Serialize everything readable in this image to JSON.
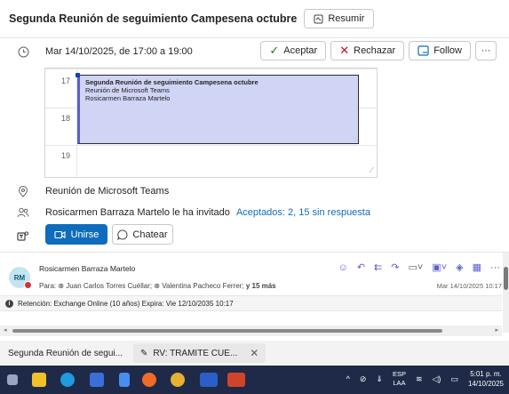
{
  "header": {
    "title": "Segunda Reunión de seguimiento Campesena octubre",
    "summarize_label": "Resumir"
  },
  "details": {
    "date_text": "Mar 14/10/2025, de 17:00 a 19:00",
    "accept_label": "Aceptar",
    "decline_label": "Rechazar",
    "follow_label": "Follow",
    "more_label": "···"
  },
  "calendar": {
    "hours": [
      "17",
      "18",
      "19"
    ],
    "event_title": "Segunda Reunión de seguimiento Campesena octubre",
    "event_location": "Reunión de Microsoft Teams",
    "event_organizer": "Rosicarmen Barraza Martelo"
  },
  "location": "Reunión de Microsoft Teams",
  "invite": {
    "text": "Rosicarmen Barraza Martelo le ha invitado",
    "status": "Aceptados: 2, 15 sin respuesta"
  },
  "meeting_actions": {
    "join_label": "Unirse",
    "chat_label": "Chatear"
  },
  "message": {
    "avatar_initials": "RM",
    "sender": "Rosicarmen Barraza Martelo",
    "to_prefix": "Para:",
    "recipient1": "Juan Carlos Torres Cuéllar;",
    "recipient2": "Valentina Pacheco Ferrer;",
    "more_recipients": "y 15 más",
    "date": "Mar 14/10/2025 10:17",
    "more_label": "···"
  },
  "retention": "Retención: Exchange Online (10 años) Expira: Vie 12/10/2035 10:17",
  "tabs": [
    {
      "label": "Segunda Reunión de segui..."
    },
    {
      "label": "RV: TRAMITE CUE..."
    }
  ],
  "taskbar": {
    "lang_line1": "ESP",
    "lang_line2": "LAA",
    "time": "5:01 p. m.",
    "date": "14/10/2025"
  },
  "colors": {
    "accent": "#0f6cbd",
    "event_bg": "#d0d4f5",
    "taskbar": "#1e2a47"
  }
}
